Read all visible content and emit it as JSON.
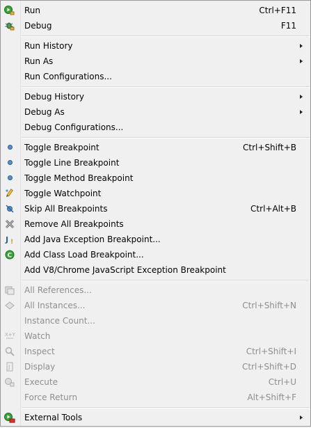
{
  "menu": {
    "run": {
      "label": "Run",
      "accel": "Ctrl+F11",
      "icon": "run-icon"
    },
    "debug": {
      "label": "Debug",
      "accel": "F11",
      "icon": "debug-icon"
    },
    "run_history": {
      "label": "Run History"
    },
    "run_as": {
      "label": "Run As"
    },
    "run_configurations": {
      "label": "Run Configurations..."
    },
    "debug_history": {
      "label": "Debug History"
    },
    "debug_as": {
      "label": "Debug As"
    },
    "debug_configurations": {
      "label": "Debug Configurations..."
    },
    "toggle_breakpoint": {
      "label": "Toggle Breakpoint",
      "accel": "Ctrl+Shift+B",
      "icon": "breakpoint-dot-icon"
    },
    "toggle_line_breakpoint": {
      "label": "Toggle Line Breakpoint",
      "icon": "breakpoint-dot-icon"
    },
    "toggle_method_breakpoint": {
      "label": "Toggle Method Breakpoint",
      "icon": "breakpoint-dot-icon"
    },
    "toggle_watchpoint": {
      "label": "Toggle Watchpoint",
      "icon": "watchpoint-icon"
    },
    "skip_all_breakpoints": {
      "label": "Skip All Breakpoints",
      "accel": "Ctrl+Alt+B",
      "icon": "skip-breakpoints-icon"
    },
    "remove_all_breakpoints": {
      "label": "Remove All Breakpoints",
      "icon": "remove-all-icon"
    },
    "add_java_exception_breakpoint": {
      "label": "Add Java Exception Breakpoint...",
      "icon": "java-exception-icon"
    },
    "add_class_load_breakpoint": {
      "label": "Add Class Load Breakpoint...",
      "icon": "class-load-icon"
    },
    "add_v8_exception_breakpoint": {
      "label": "Add V8/Chrome JavaScript Exception Breakpoint"
    },
    "all_references": {
      "label": "All References...",
      "icon": "references-icon"
    },
    "all_instances": {
      "label": "All Instances...",
      "accel": "Ctrl+Shift+N",
      "icon": "instances-icon"
    },
    "instance_count": {
      "label": "Instance Count..."
    },
    "watch": {
      "label": "Watch",
      "icon": "watch-expression-icon"
    },
    "inspect": {
      "label": "Inspect",
      "accel": "Ctrl+Shift+I",
      "icon": "inspect-icon"
    },
    "display": {
      "label": "Display",
      "accel": "Ctrl+Shift+D",
      "icon": "display-icon"
    },
    "execute": {
      "label": "Execute",
      "accel": "Ctrl+U",
      "icon": "execute-icon"
    },
    "force_return": {
      "label": "Force Return",
      "accel": "Alt+Shift+F"
    },
    "external_tools": {
      "label": "External Tools",
      "icon": "external-tools-icon"
    }
  },
  "colors": {
    "background": "#f0f0f0",
    "disabled_text": "#8e8e8e",
    "breakpoint_blue": "#5a8fc9",
    "run_green": "#3aa33a",
    "separator": "#d7d7d7"
  }
}
